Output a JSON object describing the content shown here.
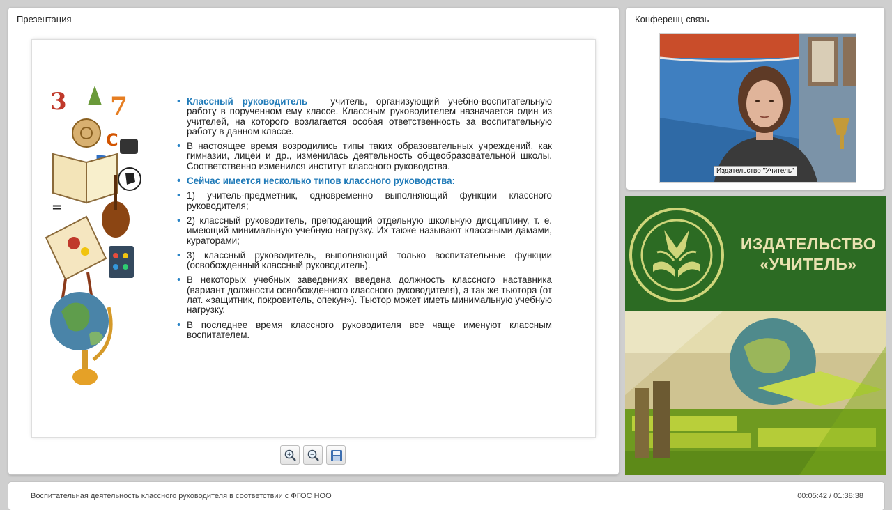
{
  "presentation": {
    "title": "Презентация"
  },
  "conference": {
    "title": "Конференц-связь",
    "speaker_caption": "Издательство \"Учитель\""
  },
  "slide": {
    "items": [
      {
        "lead": "Классный руководитель",
        "text": " – учитель, организующий учебно-воспитательную работу в порученном ему классе. Классным руководителем назначается один из учителей, на которого возлагается особая ответственность за воспитательную работу в данном классе."
      },
      {
        "text": "В настоящее время возродились типы таких образовательных учреждений, как гимназии, лицеи и др., изменилась деятельность общеобразовательной школы. Соответственно изменился институт классного руководства."
      },
      {
        "heading": "Сейчас имеется несколько типов классного руководства:"
      },
      {
        "text": "1) учитель-предметник, одновременно выполняющий функции классного руководителя;"
      },
      {
        "text": "2) классный руководитель, преподающий отдельную школьную дисциплину, т. е. имеющий минимальную учебную нагрузку. Их также называют классными дамами, кураторами;"
      },
      {
        "text": "3) классный руководитель, выполняющий только воспитательные функции (освобожденный классный руководитель)."
      },
      {
        "text": "В некоторых учебных заведениях введена должность классного наставника (вариант должности освобожденного классного руководителя), а так же тьютора (от лат. «защитник, покровитель, опекун»). Тьютор может иметь минимальную учебную нагрузку."
      },
      {
        "text": "В последнее время классного руководителя все чаще именуют классным воспитателем."
      }
    ]
  },
  "toolbar": {
    "zoom_in": "zoom-in-icon",
    "zoom_out": "zoom-out-icon",
    "save": "save-icon"
  },
  "brand": {
    "line1": "ИЗДАТЕЛЬСТВО",
    "line2": "«УЧИТЕЛЬ»",
    "green": "#2c6b23",
    "cream": "#e9e2b0"
  },
  "footer": {
    "title": "Воспитательная деятельность классного руководителя в соответствии с ФГОС НОО",
    "time": "00:05:42 / 01:38:38"
  }
}
